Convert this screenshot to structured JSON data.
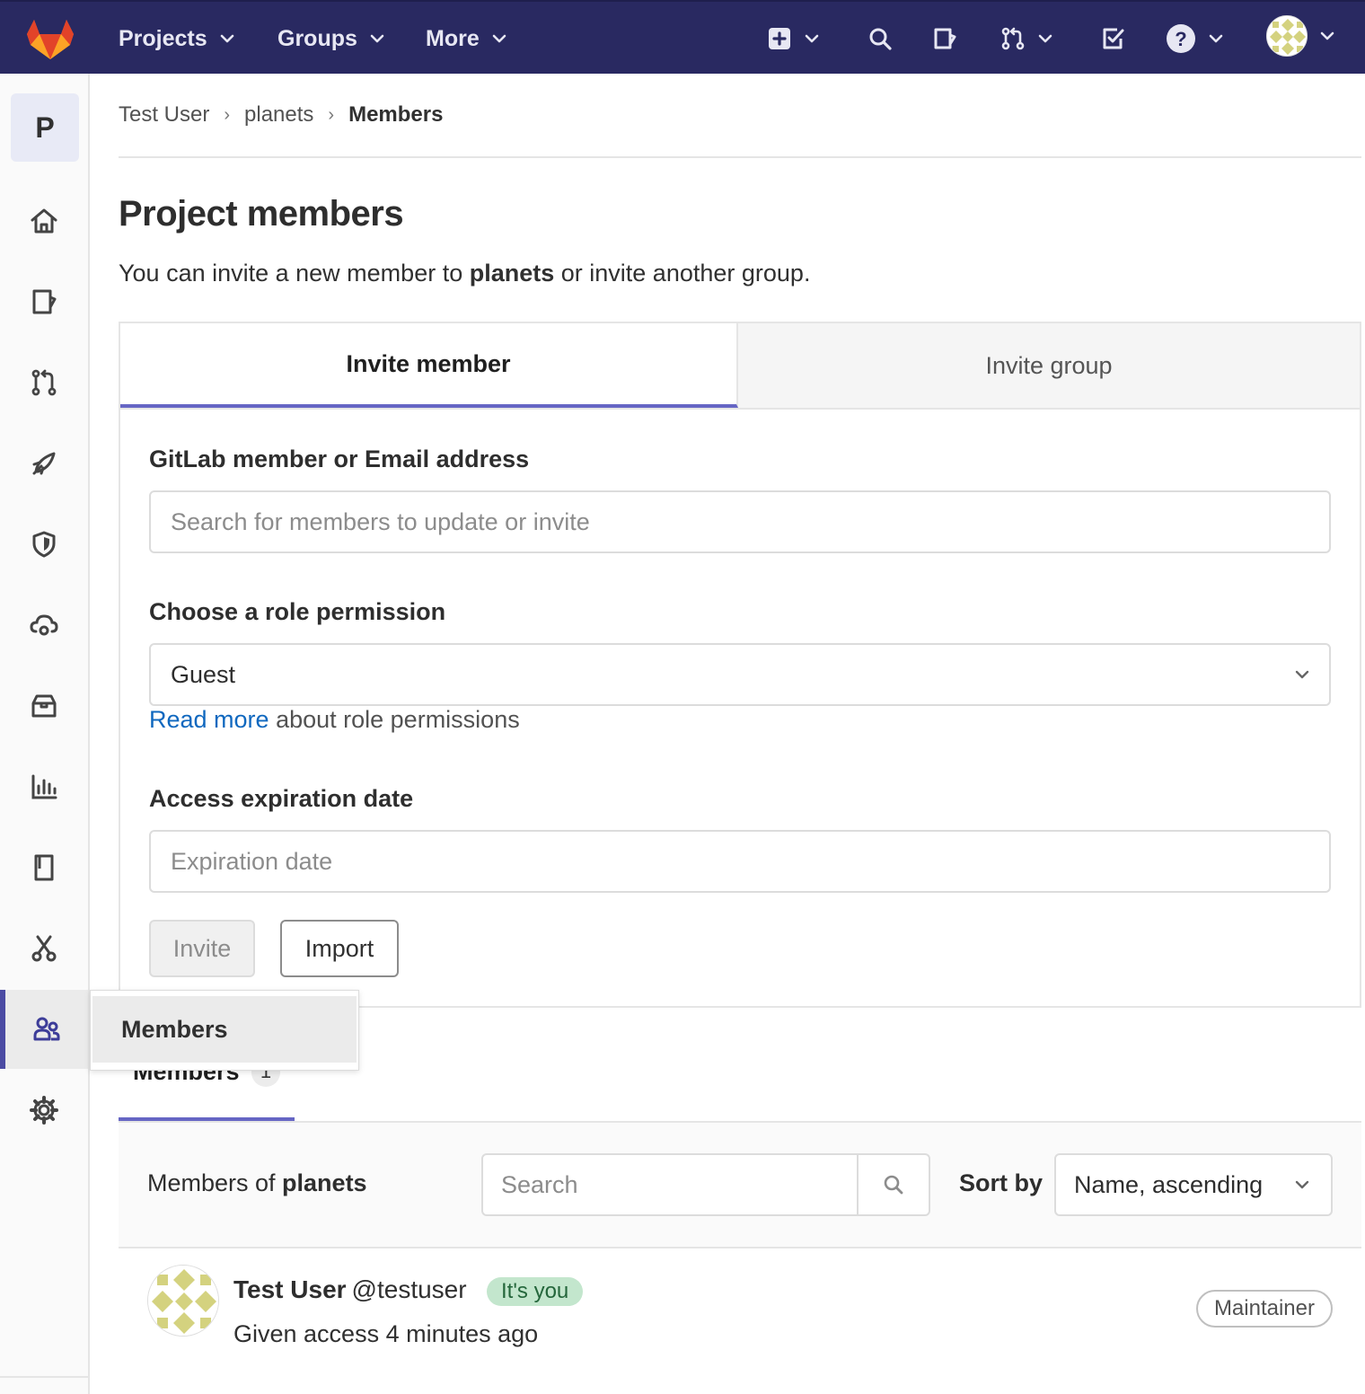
{
  "navbar": {
    "menus": [
      {
        "label": "Projects"
      },
      {
        "label": "Groups"
      },
      {
        "label": "More"
      }
    ],
    "icons": [
      "plus-square-icon",
      "search-icon",
      "issues-icon",
      "merge-request-icon",
      "todo-icon",
      "help-icon",
      "avatar"
    ]
  },
  "sidebar": {
    "project_letter": "P",
    "items": [
      "home-icon",
      "issues-icon",
      "merge-request-icon",
      "rocket-icon",
      "shield-icon",
      "cloud-gear-icon",
      "package-icon",
      "analytics-icon",
      "book-icon",
      "snippets-icon",
      "members-icon",
      "settings-icon"
    ],
    "active_item": "members-icon",
    "flyout_label": "Members"
  },
  "breadcrumb": {
    "items": [
      "Test User",
      "planets"
    ],
    "current": "Members"
  },
  "page": {
    "title": "Project members",
    "intro_prefix": "You can invite a new member to ",
    "intro_project": "planets",
    "intro_suffix": " or invite another group."
  },
  "invite": {
    "tabs": [
      {
        "label": "Invite member",
        "active": true
      },
      {
        "label": "Invite group",
        "active": false
      }
    ],
    "member_label": "GitLab member or Email address",
    "member_placeholder": "Search for members to update or invite",
    "role_label": "Choose a role permission",
    "role_value": "Guest",
    "help_link": "Read more",
    "help_text": " about role permissions",
    "expiration_label": "Access expiration date",
    "expiration_placeholder": "Expiration date",
    "invite_button": "Invite",
    "import_button": "Import"
  },
  "members": {
    "tab_label": "Members",
    "count": "1",
    "filter_prefix": "Members of ",
    "filter_project": "planets",
    "search_placeholder": "Search",
    "sort_label": "Sort by",
    "sort_value": "Name, ascending",
    "list": [
      {
        "name": "Test User",
        "handle": "@testuser",
        "badge": "It's you",
        "access": "Given access 4 minutes ago",
        "role": "Maintainer"
      }
    ]
  },
  "colors": {
    "navbar_bg": "#292961",
    "accent": "#6666c4",
    "link": "#1068bf",
    "badge_green_bg": "#c3e6cd",
    "badge_green_text": "#24663b"
  }
}
